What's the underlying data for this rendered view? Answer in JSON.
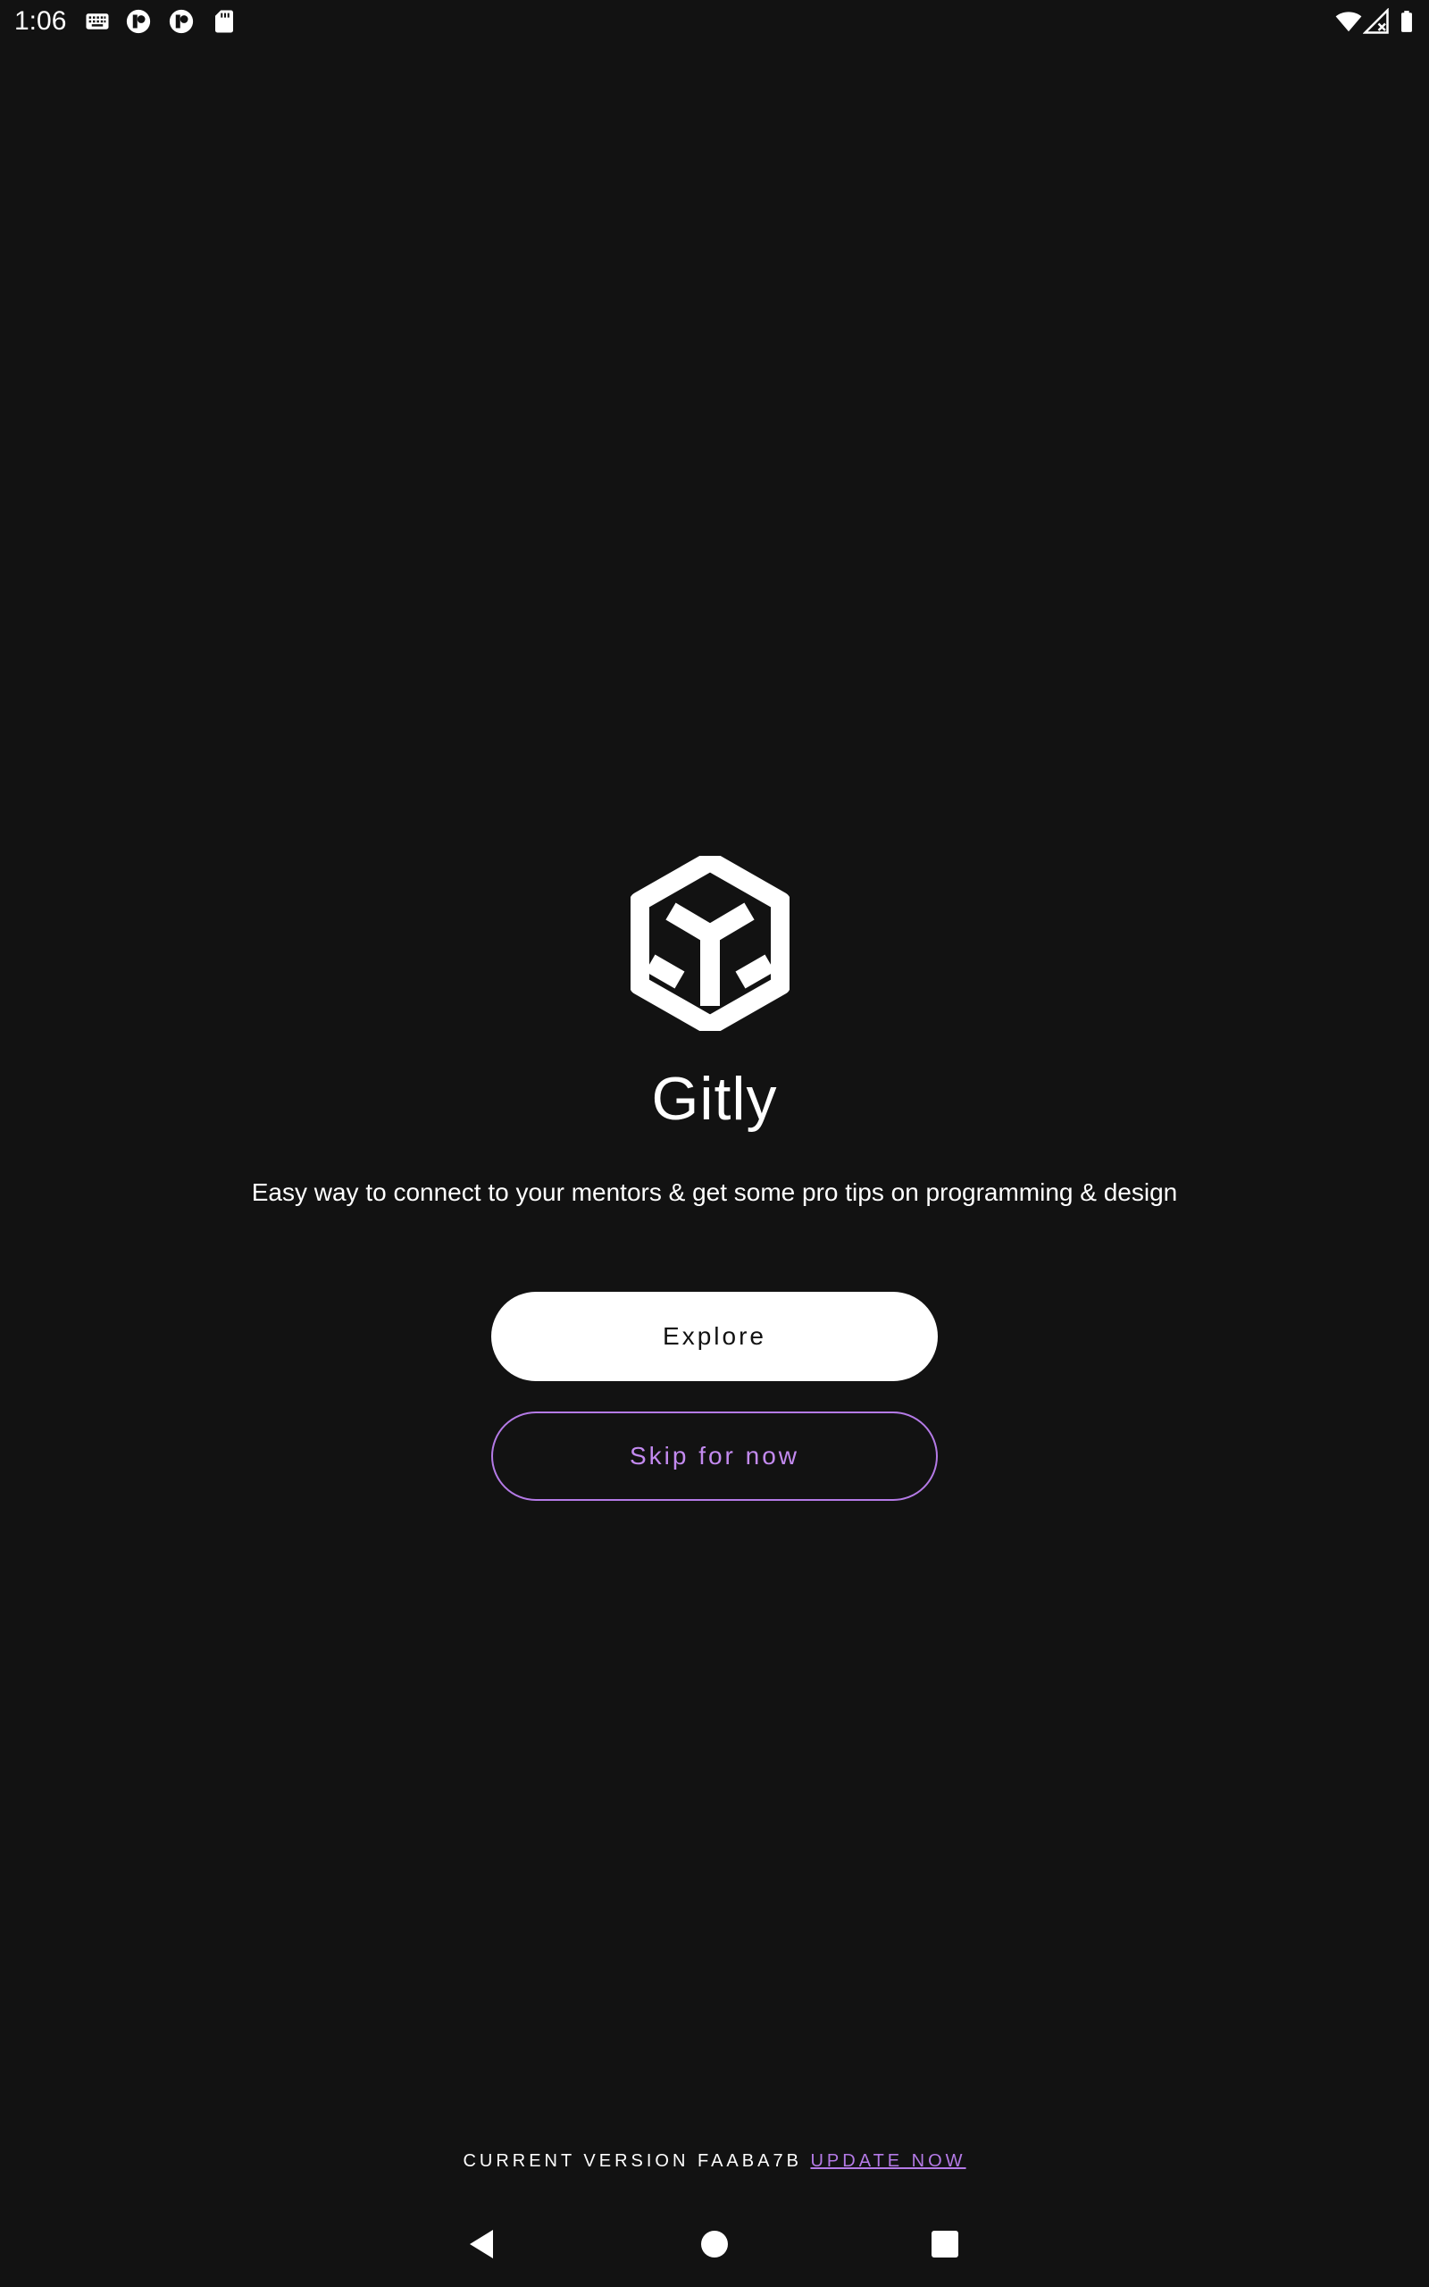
{
  "status_bar": {
    "time": "1:06",
    "left_icons": [
      "keyboard-icon",
      "app-notification-icon",
      "app-notification-icon",
      "sd-card-icon"
    ],
    "right_icons": [
      "wifi-icon",
      "cellular-no-signal-icon",
      "battery-icon"
    ]
  },
  "app": {
    "logo_icon": "cube-logo-icon",
    "title": "Gitly",
    "tagline": "Easy way to connect to your mentors & get some pro tips on programming & design"
  },
  "actions": {
    "explore_label": "Explore",
    "skip_label": "Skip for now"
  },
  "footer": {
    "version_text": "CURRENT VERSION FAABA7B",
    "update_label": "UPDATE NOW"
  },
  "nav_bar": {
    "icons": [
      "back-icon",
      "home-icon",
      "recents-icon"
    ]
  },
  "colors": {
    "background": "#121212",
    "primary_text": "#ffffff",
    "accent": "#b47ae6"
  }
}
